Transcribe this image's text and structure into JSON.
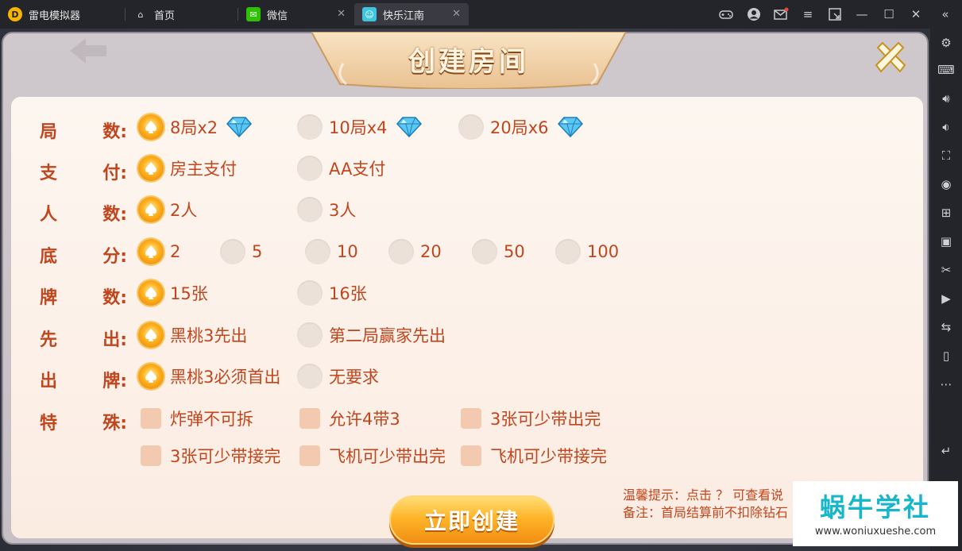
{
  "app": {
    "name": "雷电模拟器"
  },
  "tabs": [
    {
      "label": "首页"
    },
    {
      "label": "微信"
    },
    {
      "label": "快乐江南"
    }
  ],
  "dialog": {
    "title": "创建房间",
    "rows": [
      {
        "label": [
          "局",
          "数:"
        ],
        "type": "radio",
        "options": [
          {
            "text": "8局x2",
            "selected": true,
            "gem": true
          },
          {
            "text": "10局x4",
            "selected": false,
            "gem": true
          },
          {
            "text": "20局x6",
            "selected": false,
            "gem": true
          }
        ]
      },
      {
        "label": [
          "支",
          "付:"
        ],
        "type": "radio",
        "options": [
          {
            "text": "房主支付",
            "selected": true
          },
          {
            "text": "AA支付",
            "selected": false
          }
        ]
      },
      {
        "label": [
          "人",
          "数:"
        ],
        "type": "radio",
        "options": [
          {
            "text": "2人",
            "selected": true
          },
          {
            "text": "3人",
            "selected": false
          }
        ]
      },
      {
        "label": [
          "底",
          "分:"
        ],
        "type": "radio",
        "options": [
          {
            "text": "2",
            "selected": true
          },
          {
            "text": "5",
            "selected": false
          },
          {
            "text": "10",
            "selected": false
          },
          {
            "text": "20",
            "selected": false
          },
          {
            "text": "50",
            "selected": false
          },
          {
            "text": "100",
            "selected": false
          }
        ]
      },
      {
        "label": [
          "牌",
          "数:"
        ],
        "type": "radio",
        "options": [
          {
            "text": "15张",
            "selected": true
          },
          {
            "text": "16张",
            "selected": false
          }
        ]
      },
      {
        "label": [
          "先",
          "出:"
        ],
        "type": "radio",
        "options": [
          {
            "text": "黑桃3先出",
            "selected": true
          },
          {
            "text": "第二局赢家先出",
            "selected": false
          }
        ]
      },
      {
        "label": [
          "出",
          "牌:"
        ],
        "type": "radio",
        "options": [
          {
            "text": "黑桃3必须首出",
            "selected": true
          },
          {
            "text": "无要求",
            "selected": false
          }
        ]
      },
      {
        "label": [
          "特",
          "殊:"
        ],
        "type": "check",
        "options": [
          {
            "text": "炸弹不可拆",
            "checked": false
          },
          {
            "text": "允许4带3",
            "checked": false
          },
          {
            "text": "3张可少带出完",
            "checked": false
          }
        ]
      },
      {
        "label": [
          "",
          ""
        ],
        "type": "check",
        "options": [
          {
            "text": "3张可少带接完",
            "checked": false
          },
          {
            "text": "飞机可少带出完",
            "checked": false
          },
          {
            "text": "飞机可少带接完",
            "checked": false
          }
        ]
      }
    ],
    "create_button": "立即创建",
    "tips": [
      "温馨提示：点击 ？ 可查看说",
      "备注：首局结算前不扣除钻石"
    ]
  },
  "watermark": {
    "title": "蜗牛学社",
    "url": "www.woniuxueshe.com"
  },
  "colors": {
    "accent": "#c0461e",
    "gold": "#ffb01c",
    "watermark": "#17b6c8"
  }
}
